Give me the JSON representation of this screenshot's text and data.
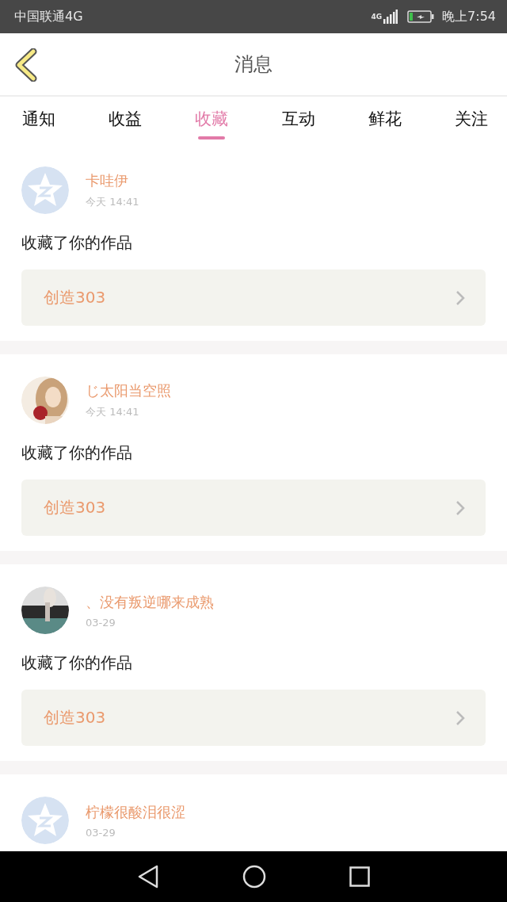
{
  "status_bar": {
    "carrier": "中国联通4G",
    "network": "4G",
    "time": "晚上7:54"
  },
  "header": {
    "title": "消息"
  },
  "tabs": [
    {
      "label": "通知",
      "selected": false
    },
    {
      "label": "收益",
      "selected": false
    },
    {
      "label": "收藏",
      "selected": true
    },
    {
      "label": "互动",
      "selected": false
    },
    {
      "label": "鲜花",
      "selected": false
    },
    {
      "label": "关注",
      "selected": false
    }
  ],
  "messages": [
    {
      "avatar": {
        "kind": "default"
      },
      "name": "卡哇伊",
      "time": "今天 14:41",
      "text": "收藏了你的作品",
      "work": "创造303"
    },
    {
      "name": "じ太阳当空照",
      "time": "今天 14:41",
      "text": "收藏了你的作品",
      "work": "创造303"
    },
    {
      "name": "、没有叛逆哪来成熟",
      "time": "03-29",
      "text": "收藏了你的作品",
      "work": "创造303"
    },
    {
      "avatar": {
        "kind": "default"
      },
      "name": "柠檬很酸泪很涩",
      "time": "03-29"
    }
  ]
}
